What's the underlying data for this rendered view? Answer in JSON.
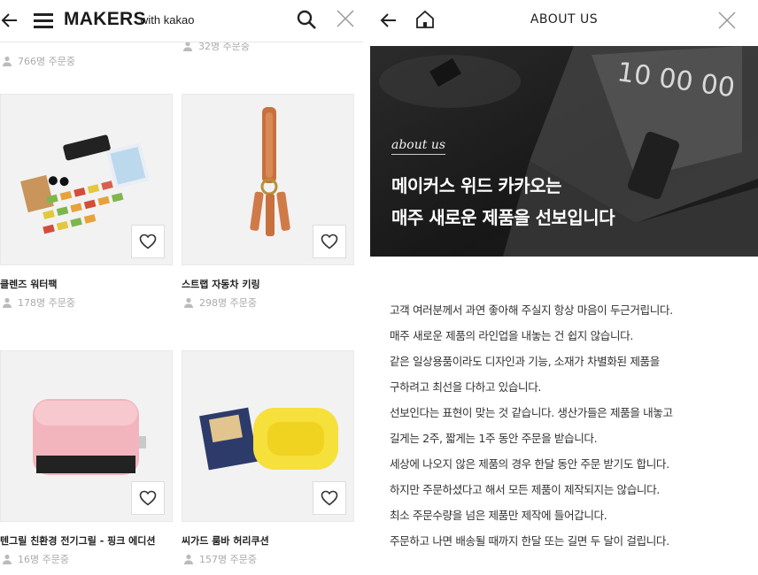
{
  "left": {
    "header": {
      "brand": "MAKERS",
      "brand_sub": "with kakao"
    },
    "top_counts": [
      "766명 주문중",
      "32명 주문중"
    ],
    "products": [
      {
        "title": "클렌즈 워터팩",
        "orders": "178명 주문중"
      },
      {
        "title": "스트랩 자동차 키링",
        "orders": "298명 주문중"
      },
      {
        "title": "텐그릴 친환경 전기그릴 - 핑크 에디션",
        "orders": "16명 주문중"
      },
      {
        "title": "씨가드 룸바 허리쿠션",
        "orders": "157명 주문중"
      }
    ]
  },
  "right": {
    "header": {
      "title": "ABOUT US"
    },
    "hero": {
      "tag": "about us",
      "headline1": "메이커스 위드 카카오는",
      "headline2": "매주 새로운 제품을 선보입니다",
      "clock": "10 00 00"
    },
    "paragraphs": [
      "고객 여러분께서 과연 좋아해 주실지 항상 마음이 두근거립니다.",
      "매주 새로운 제품의 라인업을 내놓는 건 쉽지 않습니다.",
      "같은 일상용품이라도 디자인과 기능, 소재가 차별화된 제품을",
      "구하려고 최선을 다하고 있습니다.",
      "선보인다는 표현이 맞는 것 같습니다. 생산가들은 제품을 내놓고",
      "길게는 2주, 짧게는 1주 동안 주문을 받습니다.",
      "세상에 나오지 않은 제품의 경우 한달 동안 주문 받기도 합니다.",
      "하지만 주문하셨다고 해서 모든 제품이 제작되지는 않습니다.",
      "최소 주문수량을 넘은 제품만 제작에 들어갑니다.",
      "주문하고 나면 배송될 때까지 한달 또는 길면 두 달이 걸립니다."
    ]
  },
  "colors": {
    "accent": "#222222",
    "muted": "#aaaaaa",
    "card_bg": "#f0f0f0"
  }
}
